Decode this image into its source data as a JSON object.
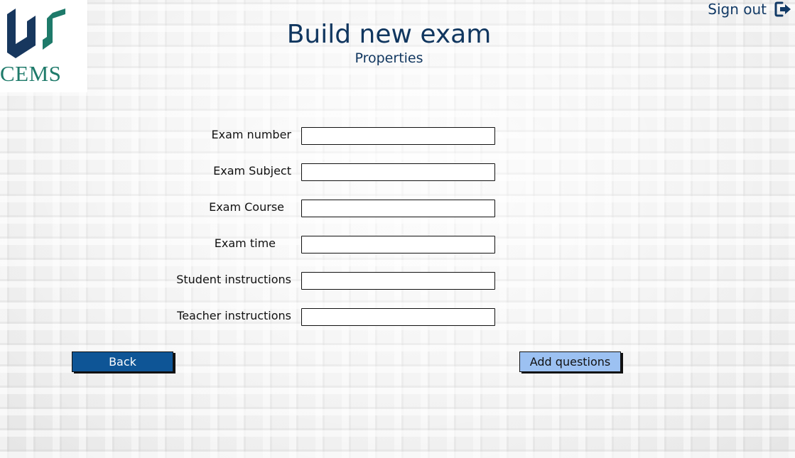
{
  "logo": {
    "text": "CEMS",
    "colors": {
      "navy": "#17375e",
      "green": "#1e7a6a"
    }
  },
  "header": {
    "title": "Build new exam",
    "subtitle": "Properties",
    "sign_out": "Sign out",
    "sign_out_icon": "sign-out-icon"
  },
  "form": {
    "fields": [
      {
        "label": "Exam number",
        "value": ""
      },
      {
        "label": "Exam Subject",
        "value": ""
      },
      {
        "label": "Exam Course",
        "value": ""
      },
      {
        "label": "Exam time",
        "value": ""
      },
      {
        "label": "Student instructions",
        "value": ""
      },
      {
        "label": "Teacher instructions",
        "value": ""
      }
    ]
  },
  "actions": {
    "back": "Back",
    "add_questions": "Add questions"
  },
  "colors": {
    "title": "#10365f",
    "back_button": "#0e5596",
    "add_button": "#9cc1f2"
  }
}
